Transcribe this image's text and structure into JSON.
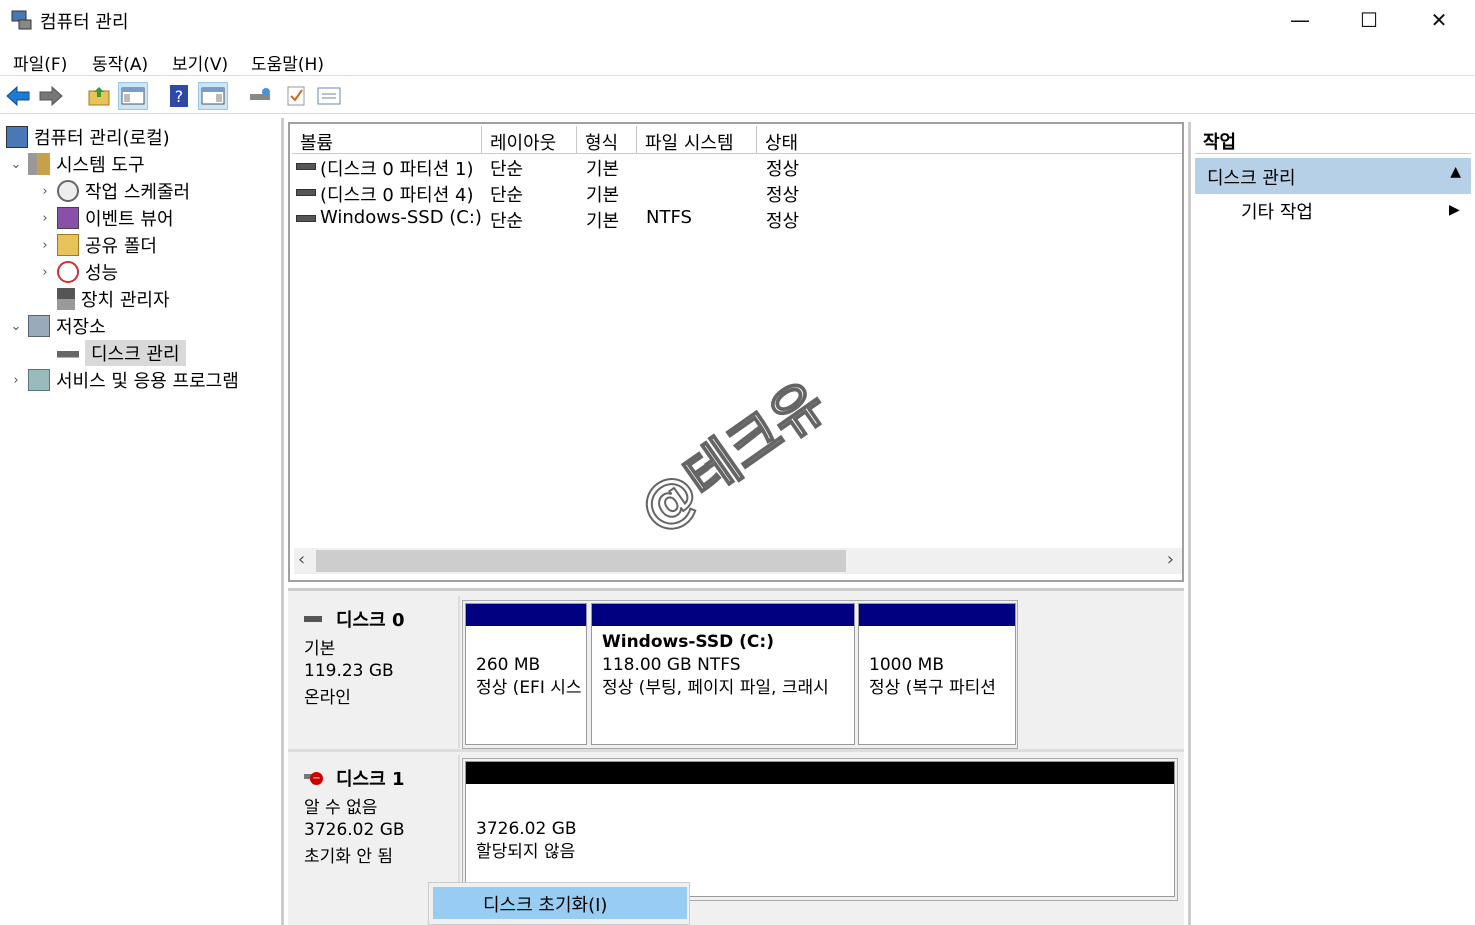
{
  "window": {
    "title": "컴퓨터 관리",
    "minimize": "—",
    "maximize": "☐",
    "close": "✕"
  },
  "menu": [
    "파일(F)",
    "동작(A)",
    "보기(V)",
    "도움말(H)"
  ],
  "toolbar": {
    "back_icon": "back-arrow-icon",
    "forward_icon": "forward-arrow-icon",
    "help": "?"
  },
  "tree": {
    "root": "컴퓨터 관리(로컬)",
    "system_tools": "시스템 도구",
    "task_scheduler": "작업 스케줄러",
    "event_viewer": "이벤트 뷰어",
    "shared_folders": "공유 폴더",
    "performance": "성능",
    "device_manager": "장치 관리자",
    "storage": "저장소",
    "disk_management": "디스크 관리",
    "services": "서비스 및 응용 프로그램"
  },
  "volumes": {
    "headers": [
      "볼륨",
      "레이아웃",
      "형식",
      "파일 시스템",
      "상태"
    ],
    "rows": [
      {
        "volume": "(디스크 0 파티션 1)",
        "layout": "단순",
        "type": "기본",
        "fs": "",
        "status": "정상"
      },
      {
        "volume": "(디스크 0 파티션 4)",
        "layout": "단순",
        "type": "기본",
        "fs": "",
        "status": "정상"
      },
      {
        "volume": "Windows-SSD (C:)",
        "layout": "단순",
        "type": "기본",
        "fs": "NTFS",
        "status": "정상"
      }
    ],
    "scroll_left": "‹",
    "scroll_right": "›"
  },
  "disk0": {
    "name": "디스크 0",
    "type": "기본",
    "size": "119.23 GB",
    "state": "온라인",
    "partitions": [
      {
        "title": "",
        "size": "260 MB",
        "status": "정상 (EFI 시스"
      },
      {
        "title": "Windows-SSD  (C:)",
        "size": "118.00 GB NTFS",
        "status": "정상 (부팅, 페이지 파일, 크래시"
      },
      {
        "title": "",
        "size": "1000 MB",
        "status": "정상 (복구 파티션"
      }
    ]
  },
  "disk1": {
    "name": "디스크 1",
    "type": "알 수 없음",
    "size": "3726.02 GB",
    "state": "초기화 안 됨",
    "unalloc_size": "3726.02 GB",
    "unalloc_label": "할당되지 않음"
  },
  "context_menu": {
    "item": "디스크 초기화(I)"
  },
  "actions": {
    "header": "작업",
    "section": "디스크 관리",
    "item": "기타 작업",
    "section_arrow": "▲",
    "item_arrow": "▶"
  },
  "watermark": "@테크유",
  "colors": {
    "partition_bar": "#000080",
    "unalloc_bar": "#000000",
    "selected": "#99ccf3"
  }
}
